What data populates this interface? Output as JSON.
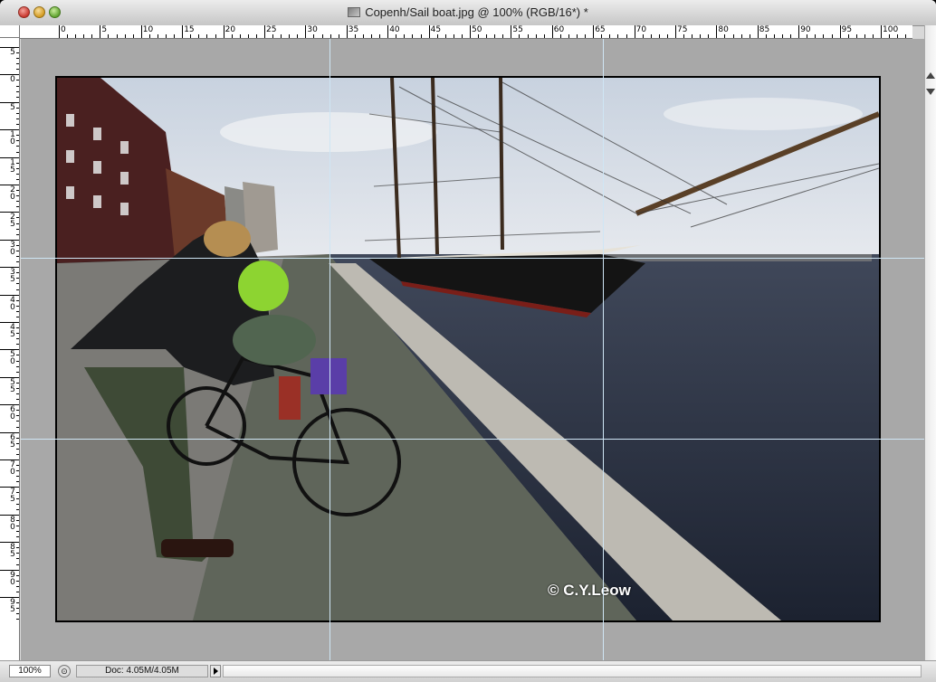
{
  "window": {
    "title": "Copenh/Sail boat.jpg @ 100% (RGB/16*) *",
    "icons": {
      "close": "close-button",
      "minimize": "minimize-button",
      "zoom": "zoom-button",
      "document": "document-icon"
    }
  },
  "ruler": {
    "top_labels": [
      "0",
      "5",
      "10",
      "15",
      "20",
      "25",
      "30",
      "35",
      "40",
      "45",
      "50",
      "55",
      "60",
      "65",
      "70",
      "75",
      "80",
      "85",
      "90",
      "95",
      "100"
    ],
    "left_labels": [
      "5",
      "0",
      "5",
      "1 0",
      "1 5",
      "2 0",
      "2 5",
      "3 0",
      "3 5",
      "4 0",
      "4 5",
      "5 0",
      "5 5",
      "6 0",
      "6 5",
      "7 0",
      "7 5",
      "8 0",
      "8 5",
      "9 0",
      "9 5"
    ]
  },
  "canvas": {
    "background": "#a8a8a8",
    "image_alt": "Photo of a man and a child on a bicycle on a cobbled quay beside a large sailing ship",
    "watermark": "© C.Y.Leow"
  },
  "status": {
    "zoom": "100%",
    "doc_info": "Doc: 4.05M/4.05M"
  }
}
